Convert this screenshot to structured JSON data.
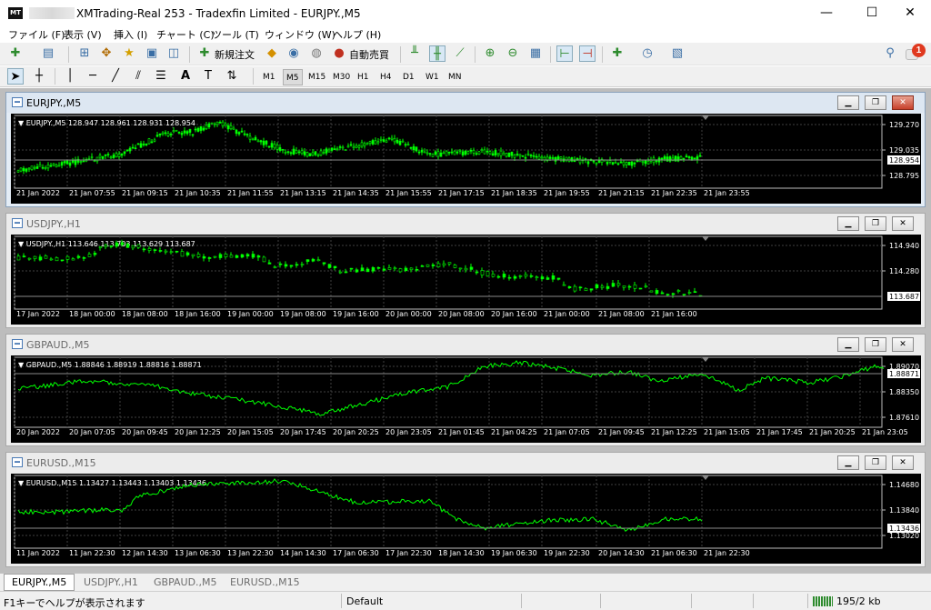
{
  "window": {
    "title": "XMTrading-Real 253 - Tradexfin Limited - EURJPY.,M5",
    "icon": "mt4-logo-icon"
  },
  "menu": [
    "ファイル (F)",
    "表示 (V)",
    "挿入 (I)",
    "チャート (C)",
    "ツール (T)",
    "ウィンドウ (W)",
    "ヘルプ (H)"
  ],
  "toolbar": {
    "new_order": "新規注文",
    "auto_trading": "自動売買",
    "notifications_count": "1",
    "timeframes": [
      "M1",
      "M5",
      "M15",
      "M30",
      "H1",
      "H4",
      "D1",
      "W1",
      "MN"
    ],
    "selected_timeframe": "M5"
  },
  "charts": [
    {
      "title": "EURJPY.,M5",
      "info": "EURJPY.,M5  128.947 128.961 128.931 128.954",
      "current": "128.954",
      "prices": [
        "129.270",
        "129.035",
        "128.795"
      ],
      "times": [
        "21 Jan 2022",
        "21 Jan 07:55",
        "21 Jan 09:15",
        "21 Jan 10:35",
        "21 Jan 11:55",
        "21 Jan 13:15",
        "21 Jan 14:35",
        "21 Jan 15:55",
        "21 Jan 17:15",
        "21 Jan 18:35",
        "21 Jan 19:55",
        "21 Jan 21:15",
        "21 Jan 22:35",
        "21 Jan 23:55"
      ],
      "active": true
    },
    {
      "title": "USDJPY.,H1",
      "info": "USDJPY.,H1  113.646 113.703 113.629 113.687",
      "current": "113.687",
      "prices": [
        "114.940",
        "114.280"
      ],
      "times": [
        "17 Jan 2022",
        "18 Jan 00:00",
        "18 Jan 08:00",
        "18 Jan 16:00",
        "19 Jan 00:00",
        "19 Jan 08:00",
        "19 Jan 16:00",
        "20 Jan 00:00",
        "20 Jan 08:00",
        "20 Jan 16:00",
        "21 Jan 00:00",
        "21 Jan 08:00",
        "21 Jan 16:00"
      ],
      "active": false
    },
    {
      "title": "GBPAUD.,M5",
      "info": "GBPAUD.,M5  1.88846 1.88919 1.88816 1.88871",
      "current": "1.88871",
      "prices": [
        "1.89070",
        "1.88350",
        "1.87610"
      ],
      "times": [
        "20 Jan 2022",
        "20 Jan 07:05",
        "20 Jan 09:45",
        "20 Jan 12:25",
        "20 Jan 15:05",
        "20 Jan 17:45",
        "20 Jan 20:25",
        "20 Jan 23:05",
        "21 Jan 01:45",
        "21 Jan 04:25",
        "21 Jan 07:05",
        "21 Jan 09:45",
        "21 Jan 12:25",
        "21 Jan 15:05",
        "21 Jan 17:45",
        "21 Jan 20:25",
        "21 Jan 23:05"
      ],
      "active": false
    },
    {
      "title": "EURUSD.,M15",
      "info": "EURUSD.,M15  1.13427 1.13443 1.13403 1.13436",
      "current": "1.13436",
      "prices": [
        "1.14680",
        "1.13840",
        "1.13020"
      ],
      "times": [
        "11 Jan 2022",
        "11 Jan 22:30",
        "12 Jan 14:30",
        "13 Jan 06:30",
        "13 Jan 22:30",
        "14 Jan 14:30",
        "17 Jan 06:30",
        "17 Jan 22:30",
        "18 Jan 14:30",
        "19 Jan 06:30",
        "19 Jan 22:30",
        "20 Jan 14:30",
        "21 Jan 06:30",
        "21 Jan 22:30"
      ],
      "active": false
    }
  ],
  "tabs": [
    "EURJPY.,M5",
    "USDJPY.,H1",
    "GBPAUD.,M5",
    "EURUSD.,M15"
  ],
  "active_tab": "EURJPY.,M5",
  "status": {
    "help": "F1キーでヘルプが表示されます",
    "profile": "Default",
    "traffic": "195/2 kb"
  },
  "colors": {
    "chart_bg": "#000000",
    "line": "#00ff00",
    "bull": "#00ff00",
    "bear": "#000000",
    "grid": "#404040",
    "axis_text": "#ffffff"
  }
}
